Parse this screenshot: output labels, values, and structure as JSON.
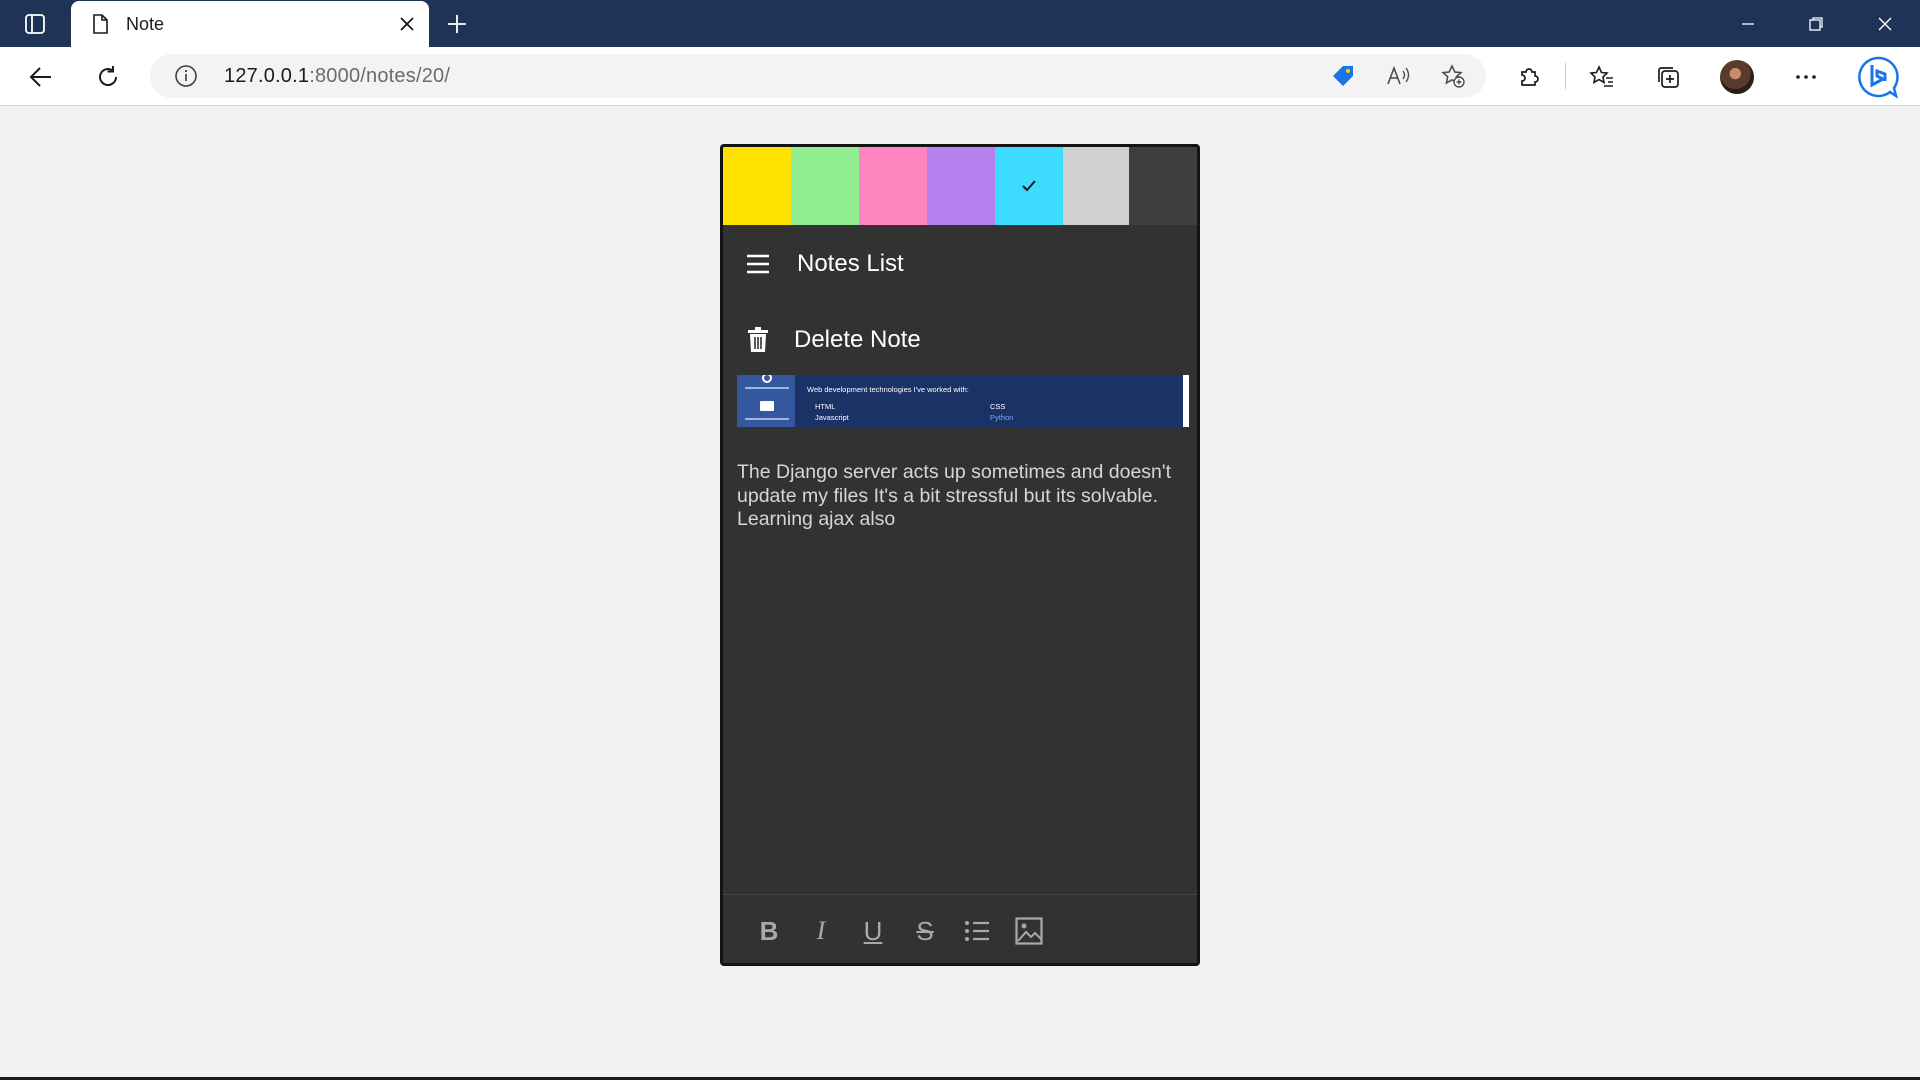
{
  "browser": {
    "tab": {
      "title": "Note"
    },
    "address": {
      "host": "127.0.0.1",
      "path": ":8000/notes/20/"
    }
  },
  "note": {
    "colors": [
      {
        "name": "yellow",
        "hex": "#fee300",
        "selected": false
      },
      {
        "name": "green",
        "hex": "#90ee90",
        "selected": false
      },
      {
        "name": "pink",
        "hex": "#ff85c0",
        "selected": false
      },
      {
        "name": "purple",
        "hex": "#b77ff0",
        "selected": false
      },
      {
        "name": "cyan",
        "hex": "#3ddcff",
        "selected": true
      },
      {
        "name": "gray",
        "hex": "#d0d0d0",
        "selected": false
      }
    ],
    "menu": {
      "notes_list": "Notes List",
      "delete_note": "Delete Note"
    },
    "embed": {
      "heading": "Web development technologies I've worked with:",
      "items": [
        "HTML",
        "CSS",
        "Javascript",
        "Python"
      ]
    },
    "body": "The Django server acts up sometimes and doesn't update my files It's a bit stressful but its solvable. Learning ajax also",
    "format_tools": [
      "bold",
      "italic",
      "underline",
      "strikethrough",
      "bulleted-list",
      "insert-image"
    ],
    "format_labels": {
      "bold": "B",
      "italic": "I",
      "underline": "U",
      "strikethrough": "S"
    }
  },
  "theme": {
    "card_bg": "#323232",
    "tabbar_bg": "#1f3357",
    "page_bg": "#f1f1f1"
  }
}
